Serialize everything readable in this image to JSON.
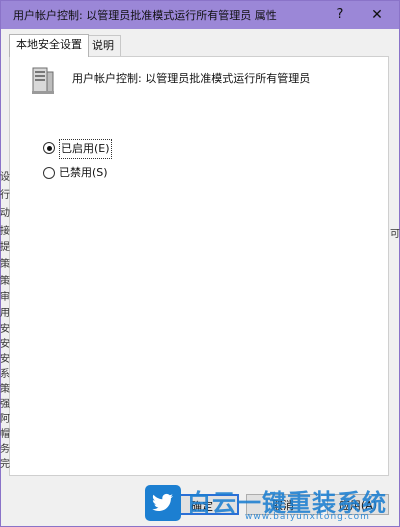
{
  "window": {
    "title": "用户帐户控制: 以管理员批准模式运行所有管理员 属性",
    "help_glyph": "?",
    "close_glyph": "✕"
  },
  "tabs": [
    {
      "label": "本地安全设置",
      "active": true
    },
    {
      "label": "说明",
      "active": false
    }
  ],
  "policy": {
    "name": "用户帐户控制: 以管理员批准模式运行所有管理员",
    "icon": "server-computer-icon"
  },
  "options": [
    {
      "label": "已启用(E)",
      "checked": true
    },
    {
      "label": "已禁用(S)",
      "checked": false
    }
  ],
  "buttons": {
    "ok": "确定",
    "cancel": "取消",
    "apply": "应用(A)"
  },
  "background_fragments": {
    "left": [
      "设",
      "行",
      "动",
      "接",
      "提",
      "策",
      "策",
      "审",
      "用",
      "安",
      "安",
      "安",
      "系",
      "策",
      "强",
      "阿",
      "帽",
      "务",
      "完"
    ],
    "right": [
      "可"
    ]
  },
  "watermark": {
    "text": "白云一键重装系统",
    "url": "www.baiyunxitong.com",
    "icon": "twitter-bird-icon",
    "color": "#1c7fd1"
  },
  "colors": {
    "titlebar": "#9b87d7",
    "focus_border": "#2b6fd6"
  }
}
